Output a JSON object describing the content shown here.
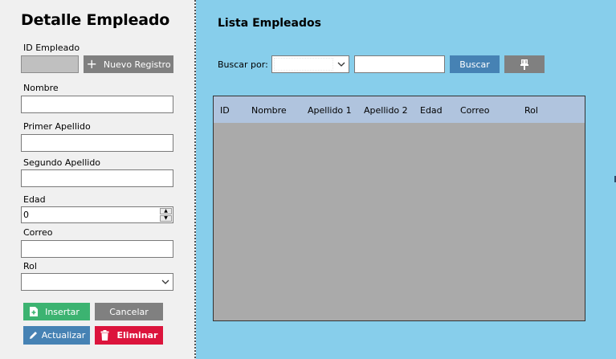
{
  "detalle": {
    "title": "Detalle Empleado",
    "id_label": "ID Empleado",
    "nuevo_registro": "Nuevo Registro",
    "nombre_label": "Nombre",
    "primer_apellido_label": "Primer Apellido",
    "segundo_apellido_label": "Segundo Apellido",
    "edad_label": "Edad",
    "edad_value": "0",
    "correo_label": "Correo",
    "rol_label": "Rol",
    "insertar": "Insertar",
    "cancelar": "Cancelar",
    "actualizar": "Actualizar",
    "eliminar": "Eliminar"
  },
  "lista": {
    "title": "Lista Empleados",
    "buscar_por_label": "Buscar por:",
    "buscar_button": "Buscar",
    "columns": [
      "ID",
      "Nombre",
      "Apellido 1",
      "Apellido 2",
      "Edad",
      "Correo",
      "Rol"
    ]
  },
  "colors": {
    "left_bg": "#f0f0f0",
    "right_bg": "#87ceeb",
    "header_bg": "#b0c4de",
    "grid_bg": "#aaaaaa",
    "insertar": "#3cb371",
    "actualizar": "#4682b4",
    "eliminar": "#dc143c",
    "neutral": "#808080"
  },
  "icons": {
    "nuevo_registro": "plus-icon",
    "insertar": "add-file-icon",
    "actualizar": "pencil-icon",
    "eliminar": "trash-icon",
    "limpiar": "brush-icon",
    "dropdown": "chevron-down-icon"
  }
}
